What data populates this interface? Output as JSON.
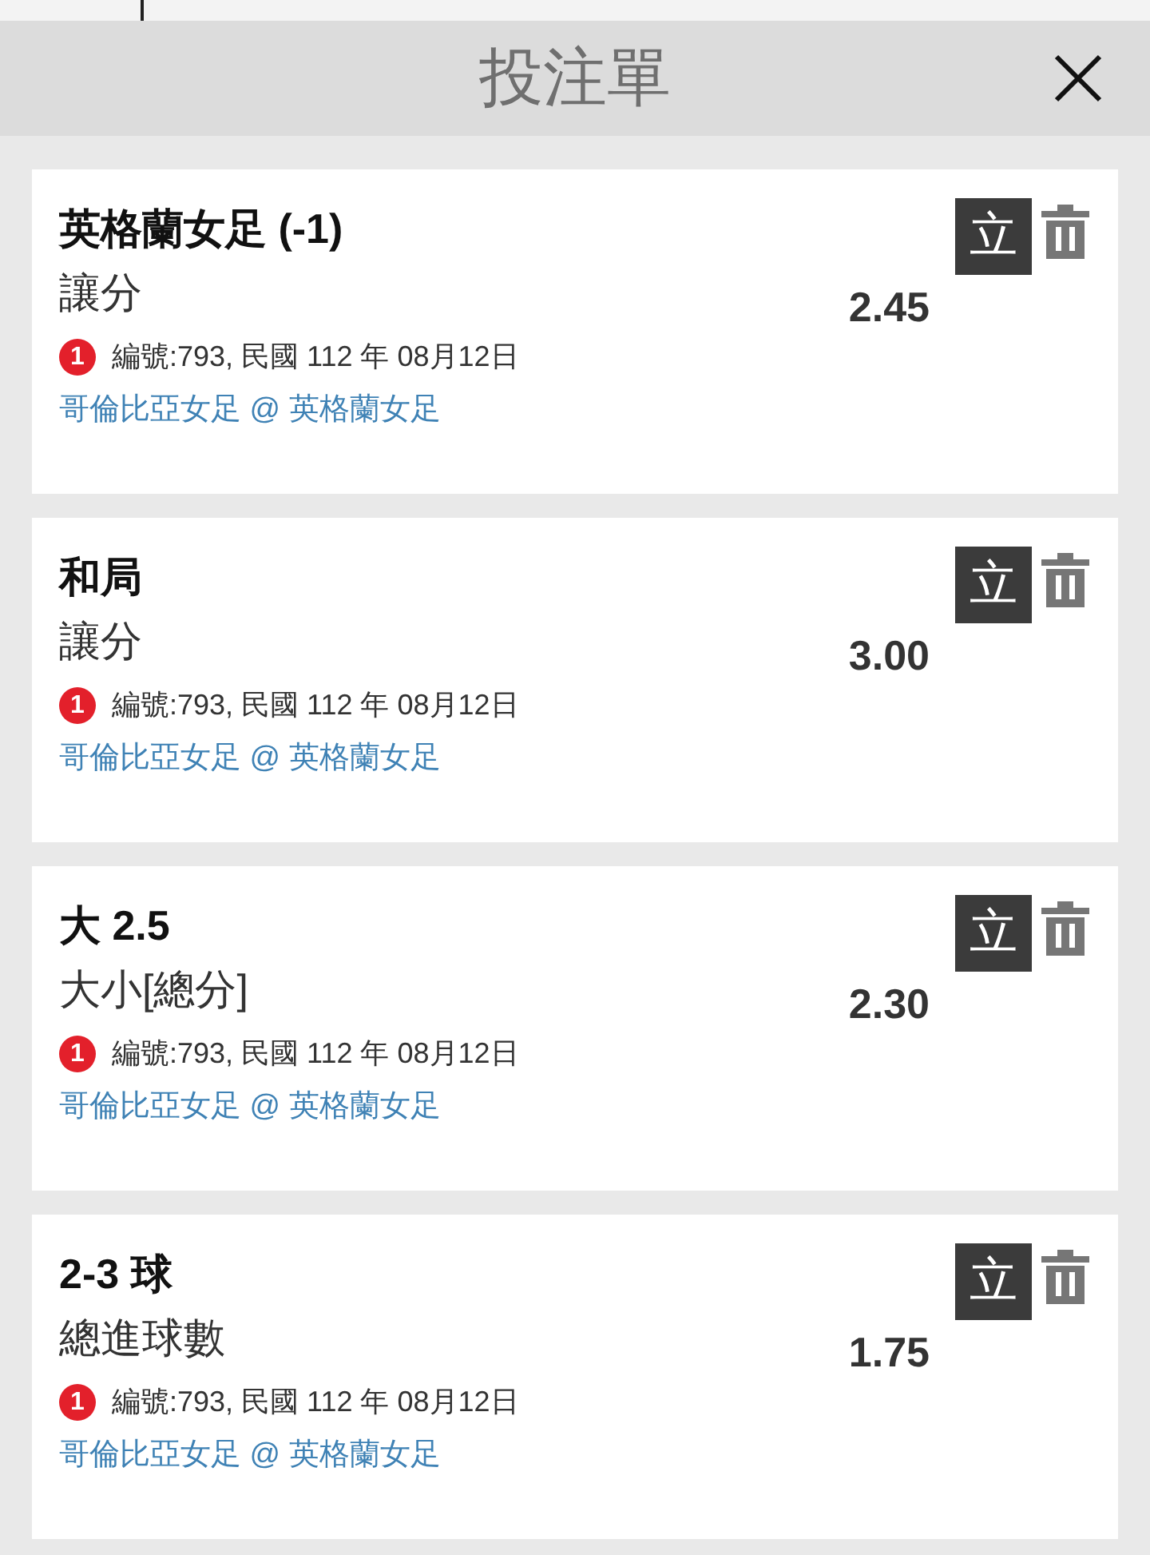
{
  "header": {
    "title": "投注單"
  },
  "bets": [
    {
      "selection": "英格蘭女足 (-1)",
      "market": "讓分",
      "odds": "2.45",
      "badge": "1",
      "info": "編號:793, 民國 112 年 08月12日",
      "match": "哥倫比亞女足 @ 英格蘭女足",
      "action": "立"
    },
    {
      "selection": "和局",
      "market": "讓分",
      "odds": "3.00",
      "badge": "1",
      "info": "編號:793, 民國 112 年 08月12日",
      "match": "哥倫比亞女足 @ 英格蘭女足",
      "action": "立"
    },
    {
      "selection": "大 2.5",
      "market": "大小[總分]",
      "odds": "2.30",
      "badge": "1",
      "info": "編號:793, 民國 112 年 08月12日",
      "match": "哥倫比亞女足 @ 英格蘭女足",
      "action": "立"
    },
    {
      "selection": "2-3 球",
      "market": "總進球數",
      "odds": "1.75",
      "badge": "1",
      "info": "編號:793, 民國 112 年 08月12日",
      "match": "哥倫比亞女足 @ 英格蘭女足",
      "action": "立"
    }
  ]
}
